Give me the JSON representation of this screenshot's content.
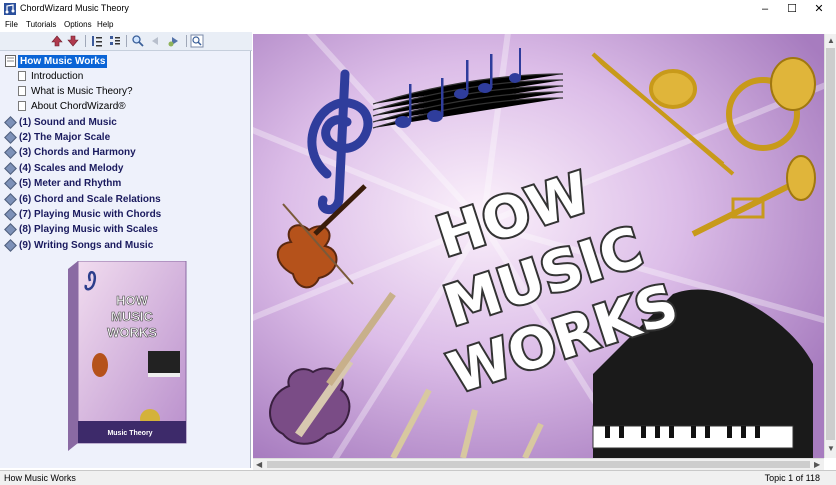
{
  "window": {
    "title": "ChordWizard Music Theory",
    "minimize": "–",
    "maximize": "☐",
    "close": "✕"
  },
  "menu": [
    "File",
    "Tutorials",
    "Options",
    "Help"
  ],
  "toolbar": {
    "icons": [
      "arrow-up-icon",
      "arrow-down-icon",
      "collapse-all-icon",
      "expand-all-icon",
      "search-icon",
      "back-icon",
      "forward-icon",
      "find-icon"
    ]
  },
  "tree": {
    "root": "How Music Works",
    "pages": [
      "Introduction",
      "What is Music Theory?",
      "About ChordWizard®"
    ],
    "chapters": [
      "(1)  Sound and Music",
      "(2)  The Major Scale",
      "(3)  Chords and Harmony",
      "(4)  Scales and Melody",
      "(5)  Meter and Rhythm",
      "(6)  Chord and Scale Relations",
      "(7)  Playing Music with Chords",
      "(8)  Playing Music with Scales",
      "(9)  Writing Songs and Music"
    ]
  },
  "product_box": {
    "title_lines": [
      "HOW",
      "MUSIC",
      "WORKS"
    ],
    "brand": "Music Theory"
  },
  "content": {
    "headline_lines": [
      "HOW",
      "MUSIC",
      "WORKS"
    ]
  },
  "status": {
    "left": "How Music Works",
    "right": "Topic 1 of 118"
  },
  "colors": {
    "selection": "#0a64d6",
    "tree_bg": "#eef1fb",
    "chapter_text": "#1a1a5e",
    "content_bg": "#d9b9e4"
  }
}
